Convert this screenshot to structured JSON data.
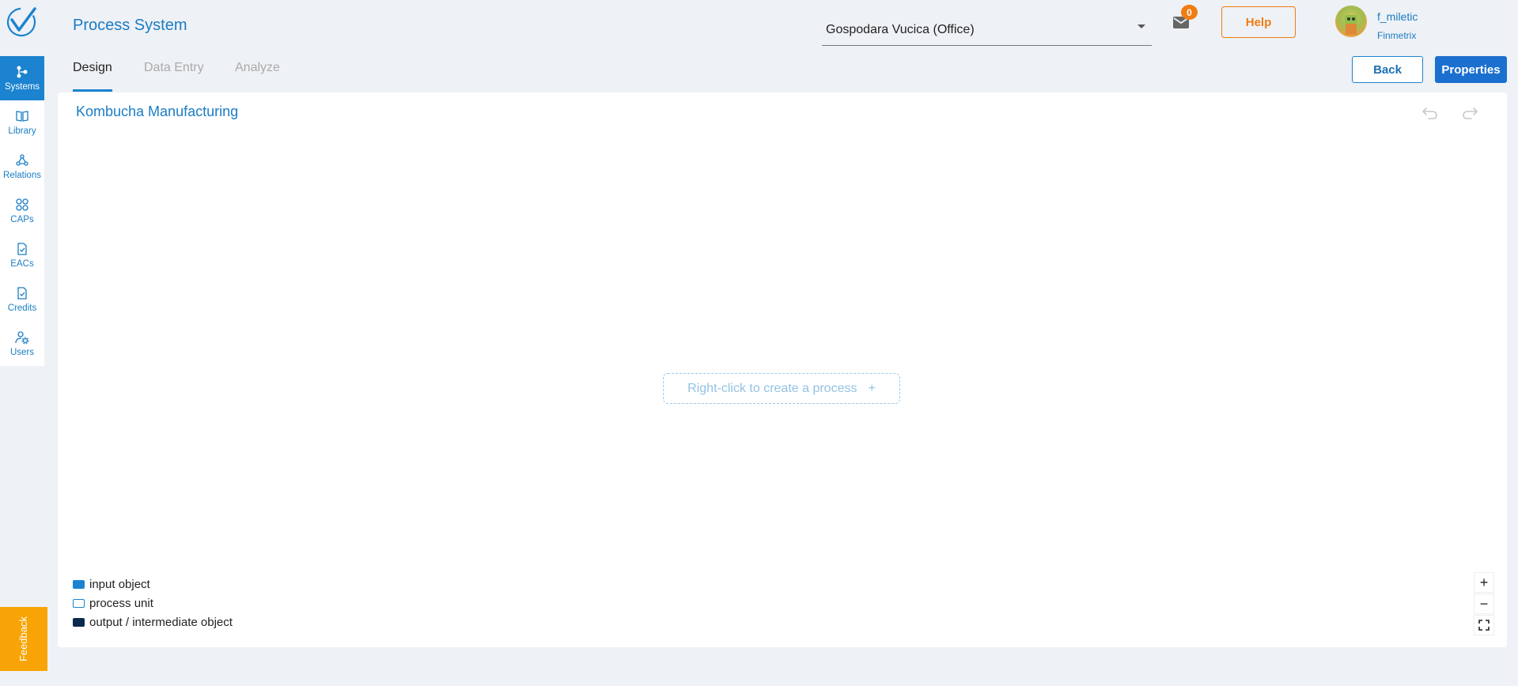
{
  "header": {
    "app_title": "Process System",
    "org_select": "Gospodara Vucica (Office)",
    "mail_count": "0",
    "help_label": "Help",
    "user_name": "f_miletic",
    "user_org": "Finmetrix"
  },
  "sidebar": {
    "items": [
      {
        "label": "Systems",
        "icon": "systems-icon",
        "active": true
      },
      {
        "label": "Library",
        "icon": "book-icon"
      },
      {
        "label": "Relations",
        "icon": "relations-icon"
      },
      {
        "label": "CAPs",
        "icon": "grid-icon"
      },
      {
        "label": "EACs",
        "icon": "document-check-icon"
      },
      {
        "label": "Credits",
        "icon": "document-check-icon"
      },
      {
        "label": "Users",
        "icon": "users-gear-icon"
      }
    ]
  },
  "tabs": [
    {
      "label": "Design",
      "active": true
    },
    {
      "label": "Data Entry"
    },
    {
      "label": "Analyze"
    }
  ],
  "actions": {
    "back_label": "Back",
    "properties_label": "Properties"
  },
  "canvas": {
    "title": "Kombucha Manufacturing",
    "hint": "Right-click to create a process",
    "hint_icon": "+"
  },
  "legend": [
    {
      "label": "input object",
      "color": "#1b83cf"
    },
    {
      "label": "process unit",
      "color": "#ffffff"
    },
    {
      "label": "output / intermediate object",
      "color": "#0d2a4c"
    }
  ],
  "zoom": {
    "in": "+",
    "out": "−"
  },
  "feedback_label": "Feedback",
  "colors": {
    "accent": "#1b83cf",
    "orange": "#f07c12",
    "feedback": "#f9a406"
  }
}
